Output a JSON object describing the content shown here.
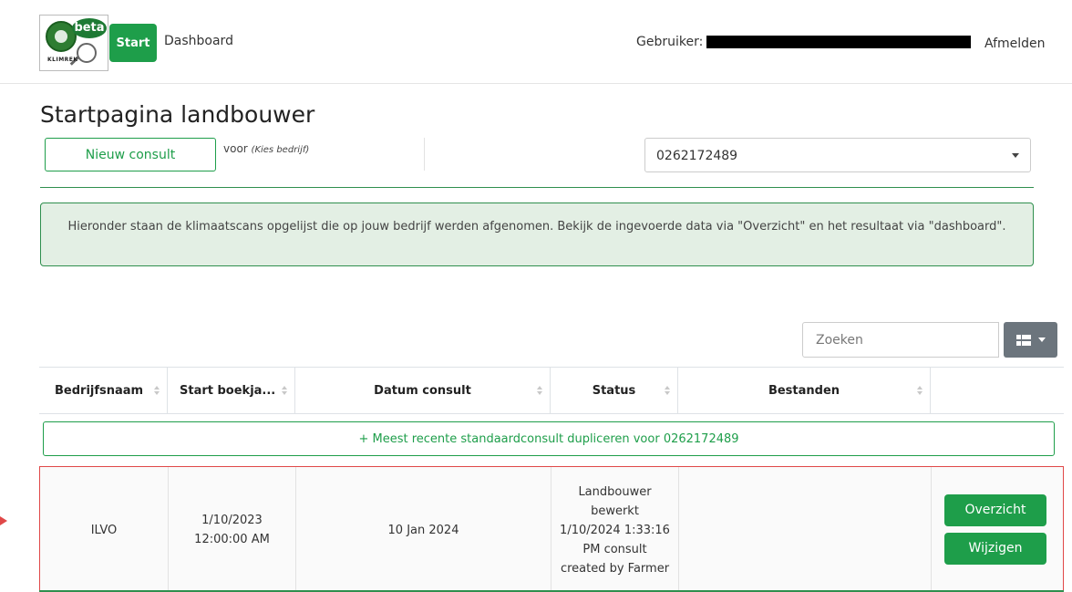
{
  "header": {
    "logo_badge": "beta",
    "logo_text": "KLIMREK",
    "start_label": "Start",
    "dashboard_label": "Dashboard",
    "user_label": "Gebruiker:",
    "logout_label": "Afmelden"
  },
  "page": {
    "title": "Startpagina landbouwer",
    "new_consult_label": "Nieuw consult",
    "voor_label": "voor",
    "voor_hint": "(Kies bedrijf)",
    "company_select_value": "0262172489",
    "info_text": "Hieronder staan de klimaatscans opgelijst die op jouw bedrijf werden afgenomen. Bekijk de ingevoerde data via \"Overzicht\" en het resultaat via \"dashboard\"."
  },
  "table_tools": {
    "search_placeholder": "Zoeken"
  },
  "table": {
    "columns": [
      "Bedrijfsnaam",
      "Start boekja...",
      "Datum consult",
      "Status",
      "Bestanden",
      ""
    ],
    "duplicate_label": "+ Meest recente standaardconsult dupliceren voor 0262172489",
    "rows": [
      {
        "bedrijfsnaam": "ILVO",
        "start_boekjaar": "1/10/2023 12:00:00 AM",
        "datum_consult": "10 Jan 2024",
        "status": "Landbouwer bewerkt 1/10/2024 1:33:16 PM consult created by Farmer",
        "bestanden": "",
        "overzicht_label": "Overzicht",
        "wijzigen_label": "Wijzigen"
      }
    ]
  },
  "colors": {
    "accent": "#1e9e4a",
    "info_bg": "#e3efe4",
    "highlight_border": "#e04848"
  }
}
